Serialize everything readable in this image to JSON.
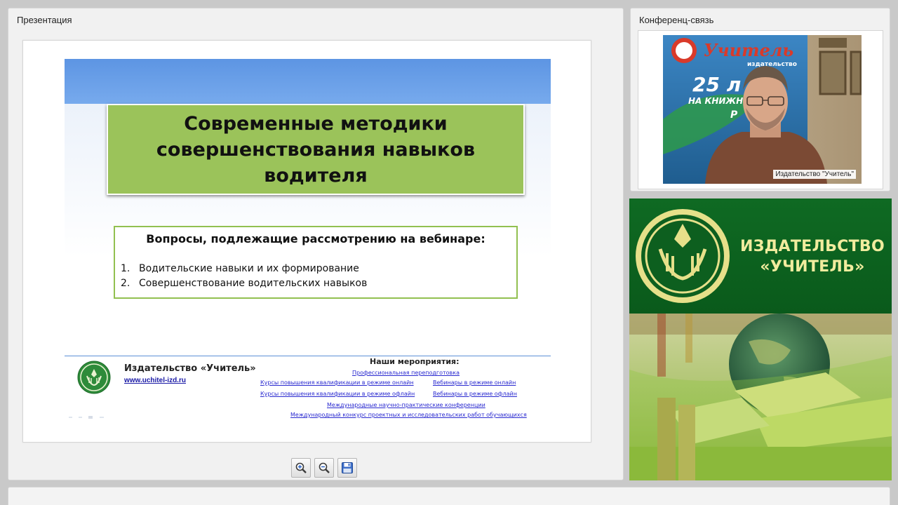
{
  "presentation_panel": {
    "title": "Презентация"
  },
  "slide": {
    "title": "Современные методики совершенствования навыков водителя",
    "questions": {
      "heading": "Вопросы, подлежащие рассмотрению на вебинаре:",
      "items": [
        {
          "num": "1.",
          "text": "Водительские навыки и их формирование"
        },
        {
          "num": "2.",
          "text": "Совершенствование водительских навыков"
        }
      ]
    },
    "footer": {
      "publisher": "Издательство «Учитель»",
      "url": "www.uchitel-izd.ru",
      "events_heading": "Наши мероприятия:",
      "events": [
        "Профессиональная переподготовка",
        "Курсы повышения квалификации в режиме онлайн",
        "Вебинары в режиме онлайн",
        "Курсы повышения квалификации в режиме офлайн",
        "Вебинары в режиме офлайн",
        "Международные научно-практические конференции",
        "Международный конкурс проектных и исследовательских работ обучающихся"
      ]
    }
  },
  "toolbar": {
    "zoom_in_icon": "zoom-in-icon",
    "zoom_out_icon": "zoom-out-icon",
    "save_icon": "floppy-disk-icon"
  },
  "conference_panel": {
    "title": "Конференц-связь",
    "caption": "Издательство \"Учитель\"",
    "background_sign": {
      "line1": "Учитель",
      "line2": "издательство",
      "line3": "25 л",
      "line4": "НА КНИЖНО",
      "line5": "Р"
    }
  },
  "banner": {
    "line1": "ИЗДАТЕЛЬСТВО",
    "line2": "«УЧИТЕЛЬ»"
  },
  "colors": {
    "slide_band": "#5d95e3",
    "title_box": "#9bc35a",
    "questions_border": "#92c050",
    "banner_green": "#0d5f1f",
    "banner_text": "#f1ec9e",
    "link": "#2a2ad0"
  }
}
